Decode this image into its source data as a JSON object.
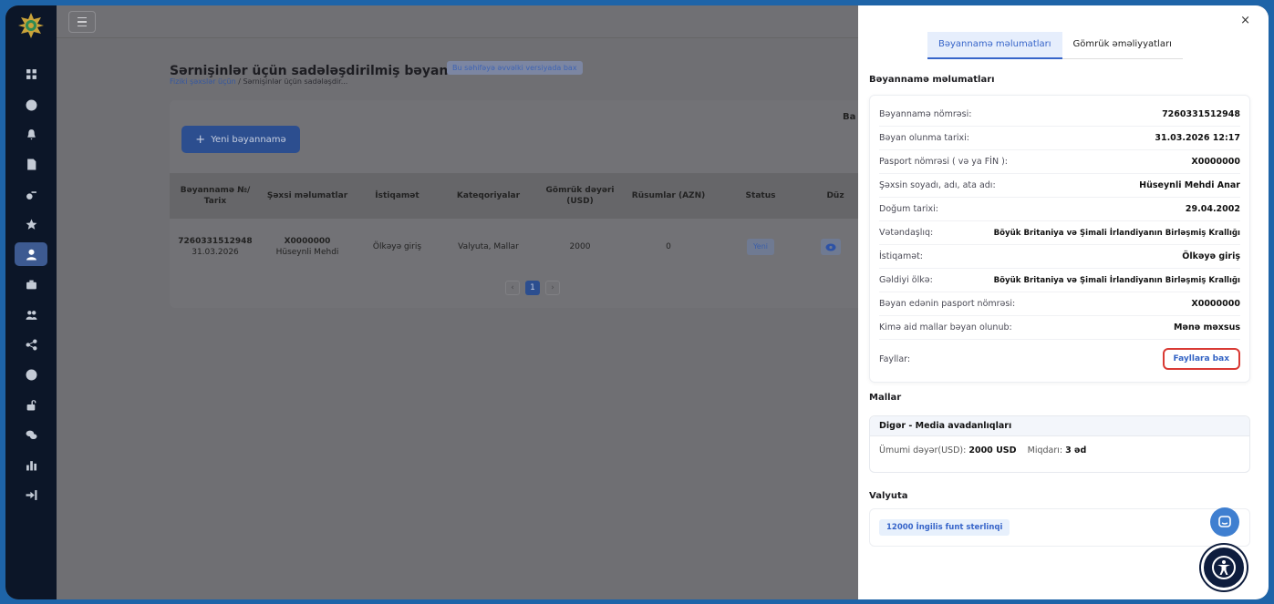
{
  "page": {
    "title": "Sərnişinlər üçün sadələşdirilmiş bəyannamə",
    "badge": "Bu səhifəyə əvvəlki versiyada bax",
    "breadcrumb_link": "Fiziki şəxslər üçün",
    "breadcrumb_sep": "/",
    "breadcrumb_current": "Sərnişinlər üçün sadələşdir...",
    "new_button": "Yeni bəyannamə",
    "new_button_icon": "+",
    "card_label": "Ba"
  },
  "table": {
    "headers": [
      "Bəyannamə №/ Tarix",
      "Şəxsi məlumatlar",
      "İstiqamət",
      "Kateqoriyalar",
      "Gömrük dəyəri (USD)",
      "Rüsumlar (AZN)",
      "Status",
      "Düz"
    ],
    "row": {
      "number": "7260331512948",
      "date": "31.03.2026",
      "passport": "X0000000",
      "person": "Hüseynli Mehdi",
      "direction": "Ölkəyə giriş",
      "categories": "Valyuta, Mallar",
      "customs_value": "2000",
      "duties": "0",
      "status": "Yeni"
    },
    "pagination": {
      "prev": "‹",
      "current": "1",
      "next": "›"
    }
  },
  "panel": {
    "close": "×",
    "tabs": [
      "Bəyannamə məlumatları",
      "Gömrük əməliyyatları"
    ],
    "section_declaration": "Bəyannamə məlumatları",
    "fields": [
      {
        "k": "Bəyannamə nömrəsi:",
        "v": "7260331512948"
      },
      {
        "k": "Bəyan olunma tarixi:",
        "v": "31.03.2026 12:17"
      },
      {
        "k": "Pasport nömrəsi ( və ya FİN ):",
        "v": "X0000000"
      },
      {
        "k": "Şəxsin soyadı, adı, ata adı:",
        "v": "Hüseynli Mehdi Anar"
      },
      {
        "k": "Doğum tarixi:",
        "v": "29.04.2002"
      },
      {
        "k": "Vətəndaşlıq:",
        "v": "Böyük Britaniya və Şimali İrlandiyanın Birləşmiş Krallığı"
      },
      {
        "k": "İstiqamət:",
        "v": "Ölkəyə giriş"
      },
      {
        "k": "Gəldiyi ölkə:",
        "v": "Böyük Britaniya və Şimali İrlandiyanın Birləşmiş Krallığı"
      },
      {
        "k": "Bəyan edənin pasport nömrəsi:",
        "v": "X0000000"
      },
      {
        "k": "Kimə aid mallar bəyan olunub:",
        "v": "Mənə məxsus"
      }
    ],
    "files_label": "Fayllar:",
    "files_button": "Fayllara bax",
    "section_goods": "Mallar",
    "goods": {
      "category": "Digər - Media avadanlıqları",
      "total_label": "Ümumi dəyər(USD):",
      "total_value": "2000 USD",
      "qty_label": "Miqdarı:",
      "qty_value": "3 əd"
    },
    "section_currency": "Valyuta",
    "currency_chip": "12000 İngilis funt sterlinqi"
  },
  "colors": {
    "accent": "#3664c9",
    "highlight_border": "#d93a34",
    "sidebar_bg": "#0c1628"
  }
}
